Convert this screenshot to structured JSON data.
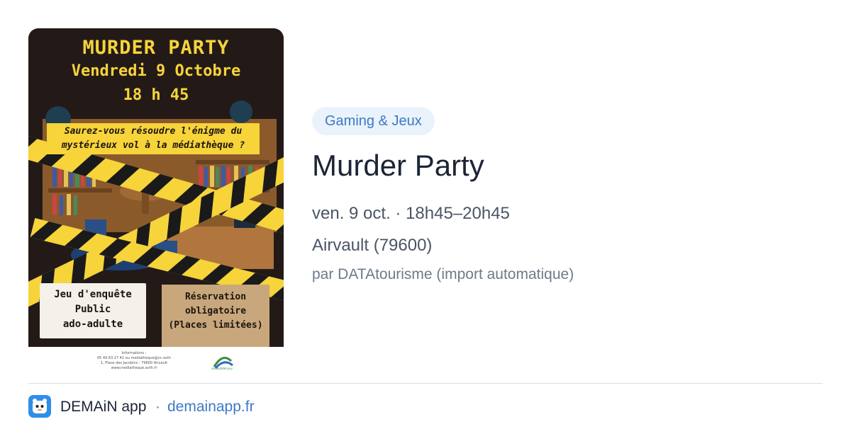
{
  "poster": {
    "title": "MURDER PARTY",
    "date": "Vendredi 9 Octobre",
    "time": "18 h 45",
    "teaser_line1": "Saurez-vous résoudre l'énigme du",
    "teaser_line2": "mystérieux vol à la médiathèque ?",
    "left_note": [
      "Jeu d'enquête",
      "Public",
      "ado-adulte"
    ],
    "right_note": [
      "Réservation",
      "obligatoire",
      "(Places limitées)"
    ],
    "footer_text": [
      "Informations :",
      "05 49 63 27 41 ou mediatheque@cc-avth",
      "1, Place des Jacobins - 79600 Airvault",
      "www.mediatheque.avth.fr"
    ],
    "logo_label": "airvaultdécouv",
    "colors": {
      "background": "#231a18",
      "accent": "#f6d43a"
    }
  },
  "event": {
    "category": "Gaming & Jeux",
    "title": "Murder Party",
    "datetime": "ven. 9 oct. · 18h45–20h45",
    "location": "Airvault (79600)",
    "source": "par DATAtourisme (import automatique)"
  },
  "footer": {
    "app_name": "DEMAiN app",
    "separator": "·",
    "link": "demainapp.fr",
    "icon": "demain-app-icon",
    "colors": {
      "icon_bg": "#2f8fe8",
      "link": "#3c7ac4"
    }
  }
}
